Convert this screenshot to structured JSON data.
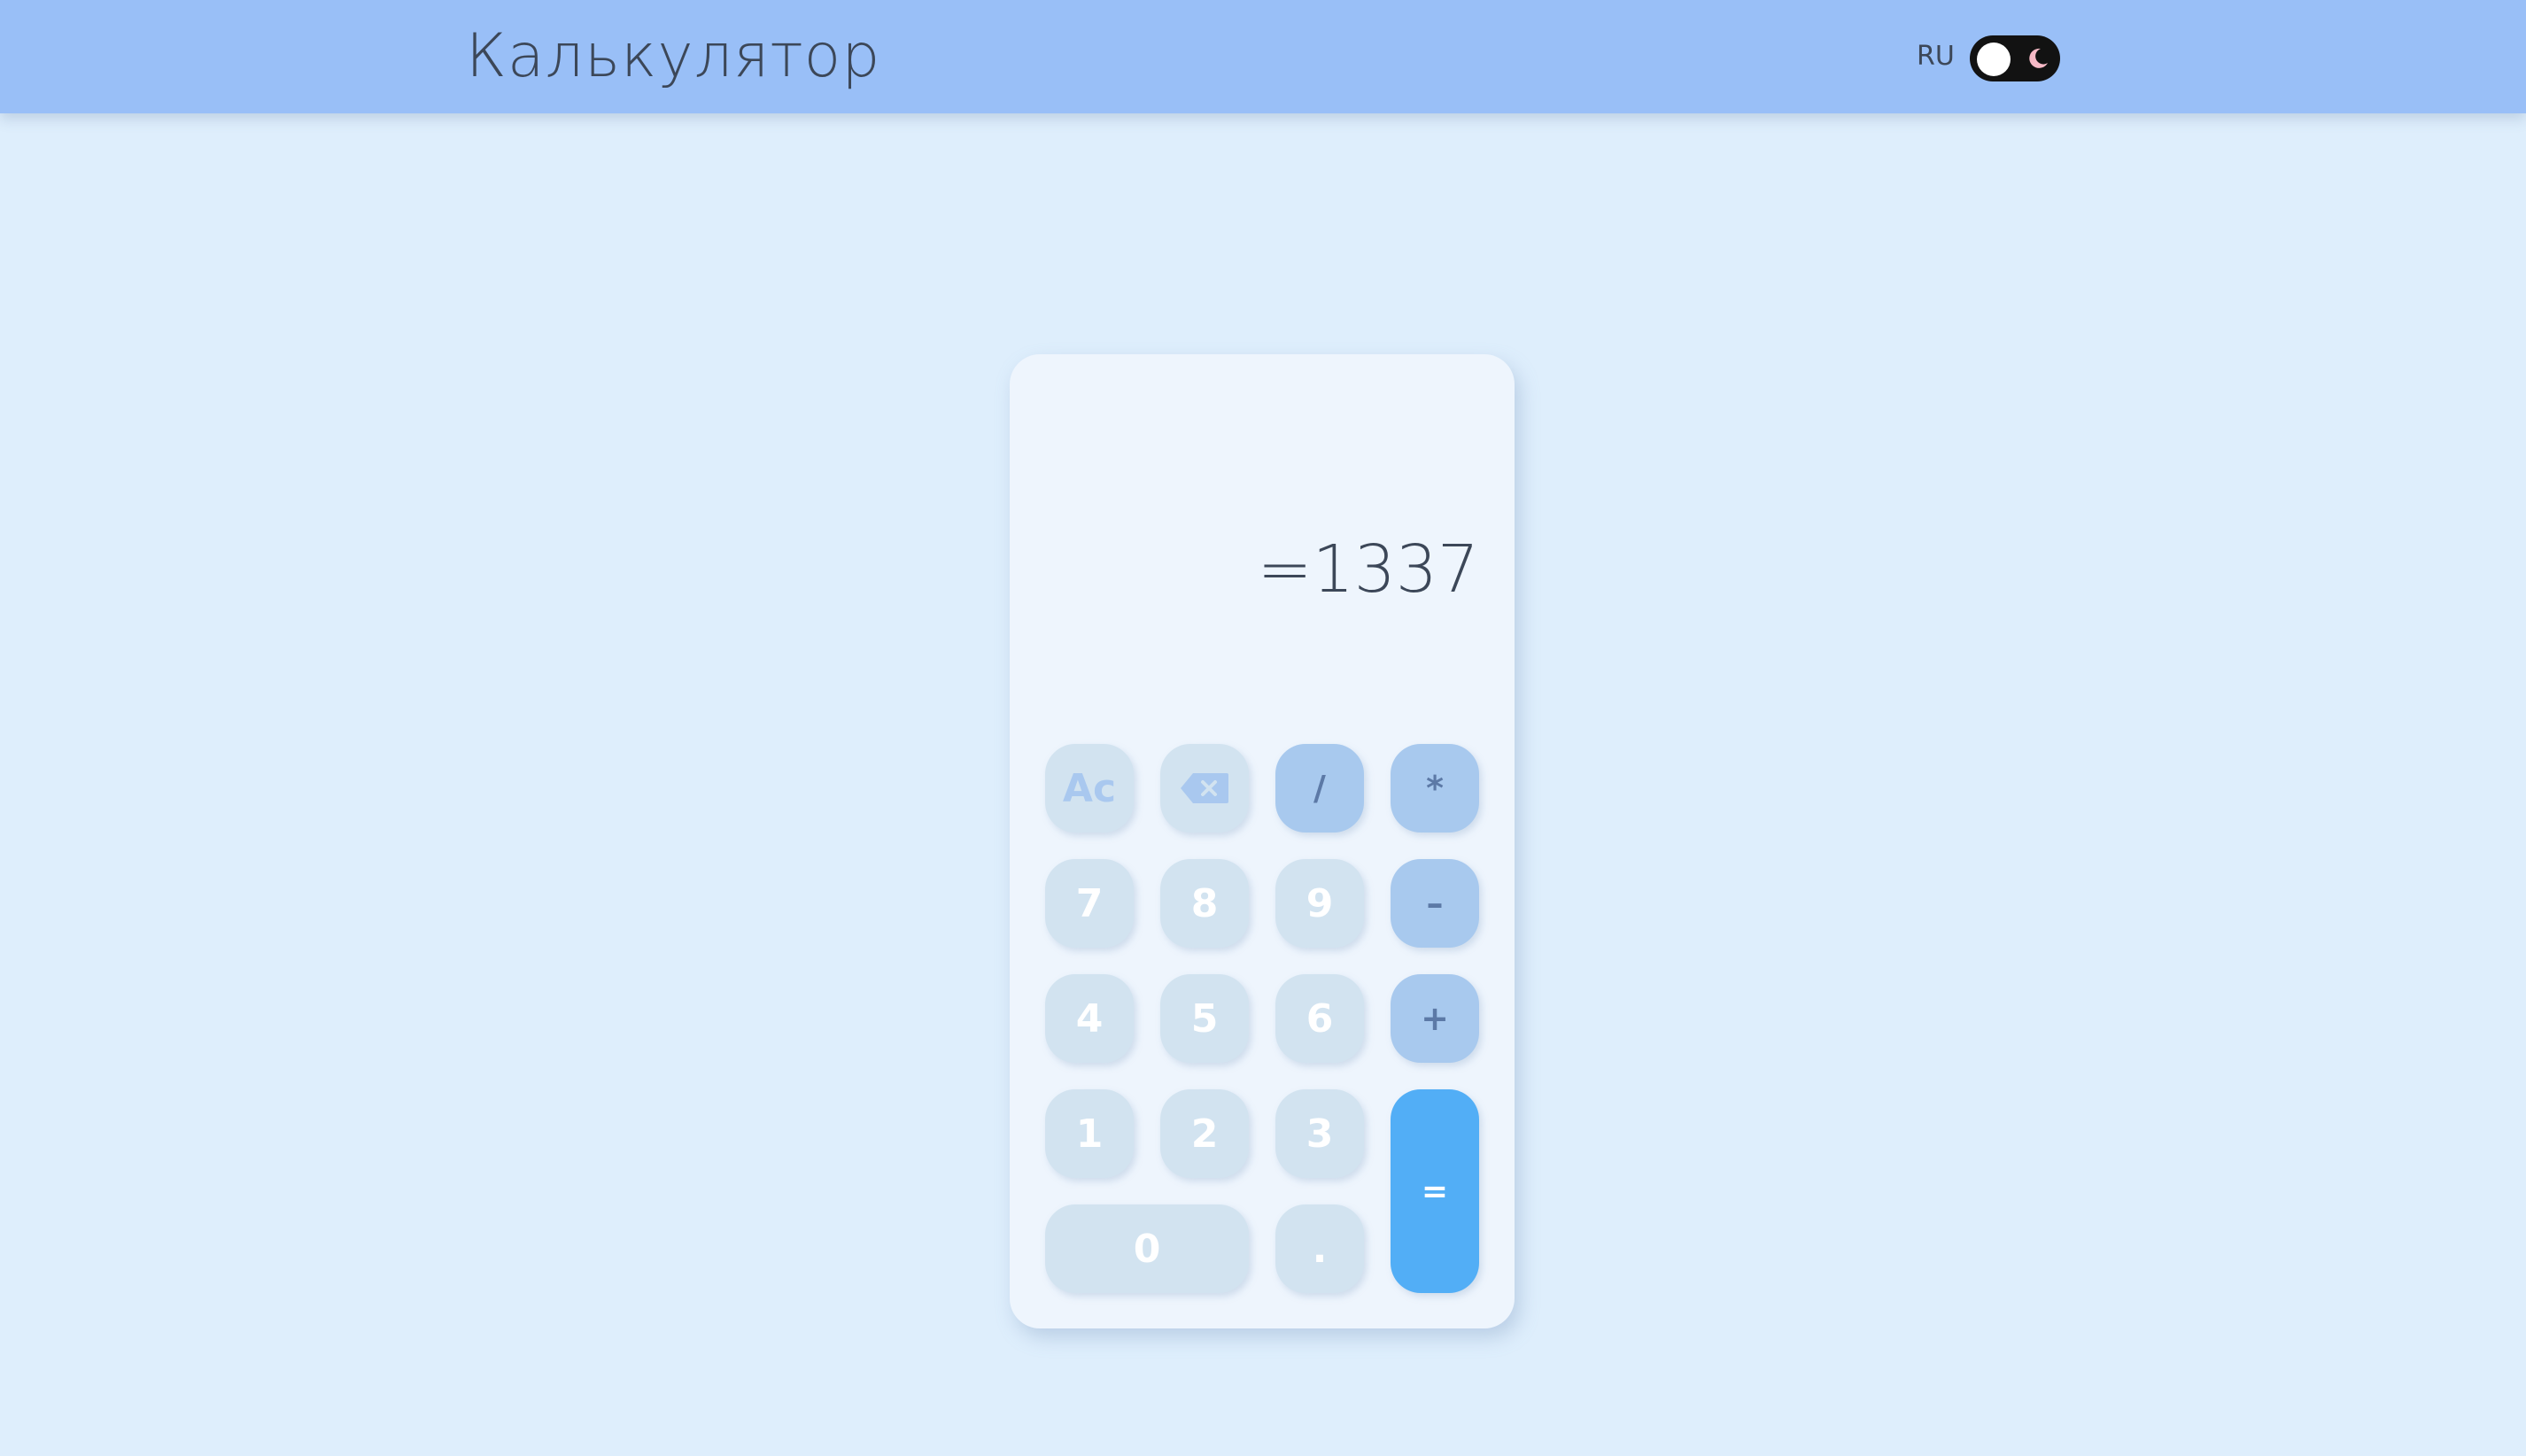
{
  "header": {
    "title": "Калькулятор",
    "language": "RU",
    "theme_toggle": {
      "state": "light",
      "icon": "moon-icon",
      "icon_color": "#f6b9c6"
    }
  },
  "calculator": {
    "display_value": "=1337",
    "keys": {
      "clear": "Ac",
      "backspace_icon": "backspace-icon",
      "divide": "/",
      "multiply": "*",
      "seven": "7",
      "eight": "8",
      "nine": "9",
      "minus": "–",
      "four": "4",
      "five": "5",
      "six": "6",
      "plus": "+",
      "one": "1",
      "two": "2",
      "three": "3",
      "equals": "=",
      "zero": "0",
      "decimal": "."
    }
  },
  "colors": {
    "header_bg": "#99bff7",
    "page_bg": "#deeefc",
    "equals_accent": "#52aef6",
    "operator_key": "#a8c9ee",
    "number_key": "#d2e3f0"
  }
}
